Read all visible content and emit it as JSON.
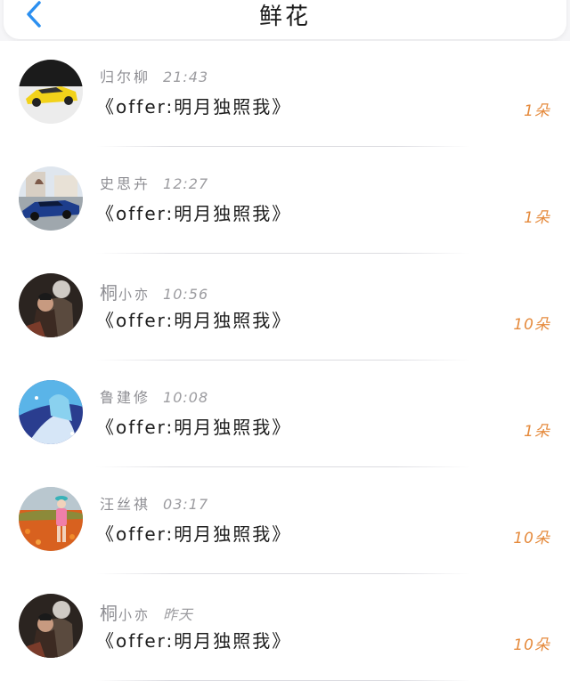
{
  "header": {
    "title": "鲜花",
    "back_icon": "chevron-left-icon"
  },
  "colors": {
    "accent": "#2b8ff0",
    "count": "#e58a3c",
    "meta": "#8e8e93"
  },
  "rows": [
    {
      "name": "归尔柳",
      "time": "21:43",
      "message": "《offer:明月独照我》",
      "count": "1朵",
      "avatar": "yellow-sports-car"
    },
    {
      "name": "史思卉",
      "time": "12:27",
      "message": "《offer:明月独照我》",
      "count": "1朵",
      "avatar": "blue-sports-car"
    },
    {
      "name_main": "桐",
      "name_tail": "小亦",
      "time": "10:56",
      "message": "《offer:明月独照我》",
      "count": "10朵",
      "avatar": "couple-portrait"
    },
    {
      "name": "鲁建修",
      "time": "10:08",
      "message": "《offer:明月独照我》",
      "count": "1朵",
      "avatar": "anime-girl"
    },
    {
      "name": "汪丝祺",
      "time": "03:17",
      "message": "《offer:明月独照我》",
      "count": "10朵",
      "avatar": "flower-field-girl"
    },
    {
      "name_main": "桐",
      "name_tail": "小亦",
      "time": "昨天",
      "message": "《offer:明月独照我》",
      "count": "10朵",
      "avatar": "couple-portrait"
    }
  ]
}
